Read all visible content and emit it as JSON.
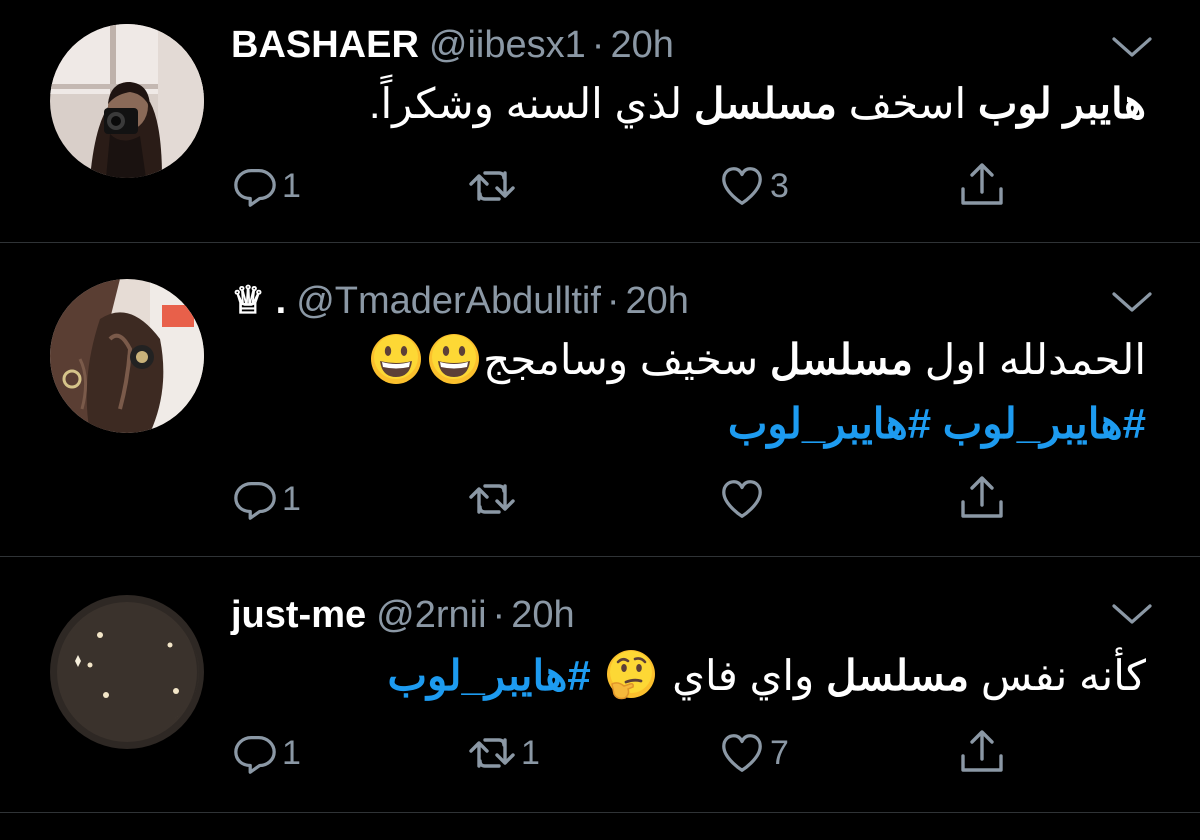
{
  "tweets": [
    {
      "display_name": "BASHAER",
      "handle": "@iibesx1",
      "separator": "·",
      "time": "20h",
      "text_parts": [
        "هايبر لوب",
        " اسخف ",
        "مسلسل",
        " لذي السنه وشكراً."
      ],
      "hashtags": "",
      "reply_count": "1",
      "retweet_count": "",
      "like_count": "3"
    },
    {
      "display_name": "♕ .",
      "handle": "@TmaderAbdulltif",
      "separator": "·",
      "time": "20h",
      "text_parts": [
        "الحمدلله اول ",
        "مسلسل",
        " سخيف وسامجج"
      ],
      "emojis": [
        "grinning-face-emoji",
        "grinning-face-emoji"
      ],
      "hashtags": "#هايبر_لوب #هايبر_لوب",
      "reply_count": "1",
      "retweet_count": "",
      "like_count": ""
    },
    {
      "display_name": "just-me",
      "handle": "@2rnii",
      "separator": "·",
      "time": "20h",
      "text_parts": [
        "كأنه نفس ",
        "مسلسل",
        " واي فاي"
      ],
      "emojis": [
        "thinking-face-emoji"
      ],
      "hashtags": "#هايبر_لوب",
      "reply_count": "1",
      "retweet_count": "1",
      "like_count": "7"
    }
  ],
  "colors": {
    "background": "#000000",
    "text": "#ffffff",
    "secondary": "#8b98a5",
    "link": "#1d9bf0",
    "divider": "#2f3336"
  },
  "icons": [
    "reply-icon",
    "retweet-icon",
    "like-icon",
    "share-icon",
    "chevron-down-icon"
  ]
}
